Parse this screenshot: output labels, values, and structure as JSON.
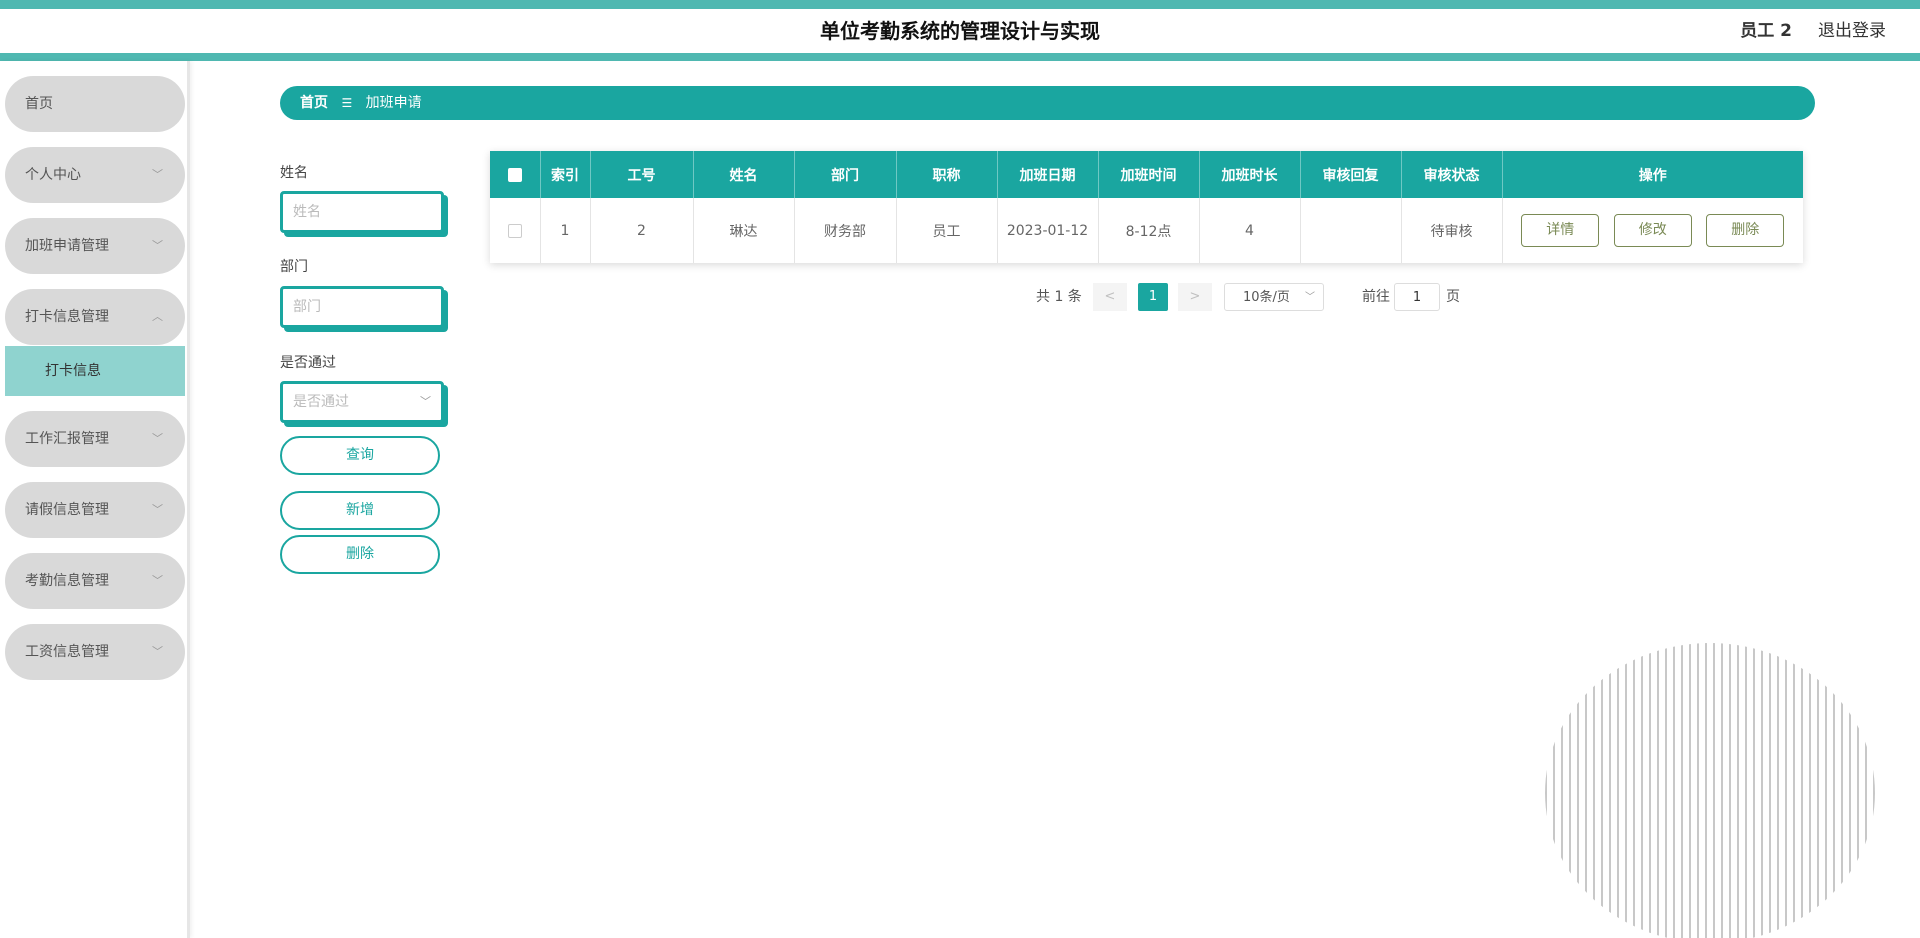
{
  "header": {
    "title": "单位考勤系统的管理设计与实现",
    "user": "员工 2",
    "logout": "退出登录"
  },
  "sidebar": {
    "items": [
      {
        "label": "首页"
      },
      {
        "label": "个人中心"
      },
      {
        "label": "加班申请管理"
      },
      {
        "label": "打卡信息管理"
      },
      {
        "label": "工作汇报管理"
      },
      {
        "label": "请假信息管理"
      },
      {
        "label": "考勤信息管理"
      },
      {
        "label": "工资信息管理"
      }
    ],
    "active_sub": "打卡信息"
  },
  "breadcrumb": {
    "home": "首页",
    "separator": "☰",
    "current": "加班申请"
  },
  "search": {
    "name_label": "姓名",
    "name_placeholder": "姓名",
    "dept_label": "部门",
    "dept_placeholder": "部门",
    "passed_label": "是否通过",
    "passed_placeholder": "是否通过",
    "query": "查询",
    "add": "新增",
    "delete": "删除"
  },
  "table": {
    "headers": [
      "索引",
      "工号",
      "姓名",
      "部门",
      "职称",
      "加班日期",
      "加班时间",
      "加班时长",
      "审核回复",
      "审核状态",
      "操作"
    ],
    "rows": [
      {
        "index": "1",
        "emp_no": "2",
        "name": "琳达",
        "dept": "财务部",
        "title": "员工",
        "date": "2023-01-12",
        "time": "8-12点",
        "duration": "4",
        "reply": "",
        "status": "待审核",
        "actions": [
          "详情",
          "修改",
          "删除"
        ]
      }
    ]
  },
  "pagination": {
    "total": "共 1 条",
    "prev": "<",
    "current": "1",
    "next": ">",
    "page_size": "10条/页",
    "goto_label": "前往",
    "goto_value": "1",
    "page_unit": "页"
  },
  "colors": {
    "primary": "#1aa6a0",
    "stripe": "#4fb8b1",
    "submenu_active": "#8fd3cf"
  }
}
